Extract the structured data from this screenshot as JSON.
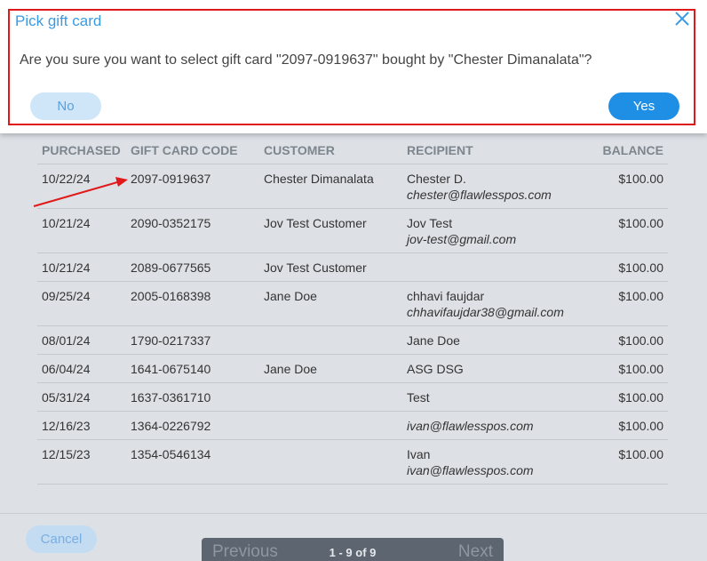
{
  "dialog": {
    "title": "Pick gift card",
    "message": "Are you sure you want to select gift card \"2097-0919637\" bought by \"Chester Dimanalata\"?",
    "no_label": "No",
    "yes_label": "Yes"
  },
  "table": {
    "headers": [
      "PURCHASED",
      "GIFT CARD CODE",
      "CUSTOMER",
      "RECIPIENT",
      "BALANCE"
    ],
    "rows": [
      {
        "purchased": "10/22/24",
        "code": "2097-0919637",
        "customer": "Chester Dimanalata",
        "recipient_name": "Chester D.",
        "recipient_email": "chester@flawlesspos.com",
        "balance": "$100.00"
      },
      {
        "purchased": "10/21/24",
        "code": "2090-0352175",
        "customer": "Jov Test Customer",
        "recipient_name": "Jov Test",
        "recipient_email": "jov-test@gmail.com",
        "balance": "$100.00"
      },
      {
        "purchased": "10/21/24",
        "code": "2089-0677565",
        "customer": "Jov Test Customer",
        "recipient_name": "",
        "recipient_email": "",
        "balance": "$100.00"
      },
      {
        "purchased": "09/25/24",
        "code": "2005-0168398",
        "customer": "Jane Doe",
        "recipient_name": "chhavi faujdar",
        "recipient_email": "chhavifaujdar38@gmail.com",
        "balance": "$100.00"
      },
      {
        "purchased": "08/01/24",
        "code": "1790-0217337",
        "customer": "",
        "recipient_name": "Jane Doe",
        "recipient_email": "",
        "balance": "$100.00"
      },
      {
        "purchased": "06/04/24",
        "code": "1641-0675140",
        "customer": "Jane Doe",
        "recipient_name": "ASG DSG",
        "recipient_email": "",
        "balance": "$100.00"
      },
      {
        "purchased": "05/31/24",
        "code": "1637-0361710",
        "customer": "",
        "recipient_name": "Test",
        "recipient_email": "",
        "balance": "$100.00"
      },
      {
        "purchased": "12/16/23",
        "code": "1364-0226792",
        "customer": "",
        "recipient_name": "",
        "recipient_email": "ivan@flawlesspos.com",
        "balance": "$100.00"
      },
      {
        "purchased": "12/15/23",
        "code": "1354-0546134",
        "customer": "",
        "recipient_name": "Ivan",
        "recipient_email": "ivan@flawlesspos.com",
        "balance": "$100.00"
      }
    ]
  },
  "footer": {
    "cancel_label": "Cancel",
    "previous_label": "Previous",
    "next_label": "Next",
    "page_info": "1 - 9 of 9"
  },
  "colors": {
    "accent": "#1f8fe5",
    "highlight_border": "#e01a1a",
    "annotation_arrow": "#e01a1a"
  },
  "icons": {
    "close": "close-icon"
  }
}
